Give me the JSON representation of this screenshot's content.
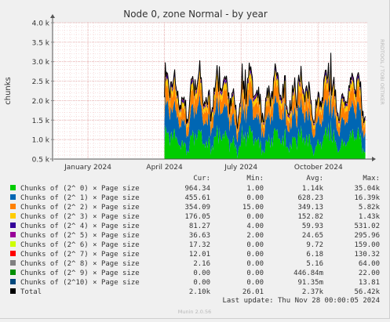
{
  "chart_data": {
    "type": "area",
    "title": "Node 0, zone Normal - by year",
    "ylabel": "chunks",
    "watermark": "RRDTOOL / TOBI OETIKER",
    "ylim": [
      500,
      4000
    ],
    "yticks": [
      {
        "value": 500,
        "label": "0.5 k"
      },
      {
        "value": 1000,
        "label": "1.0 k"
      },
      {
        "value": 1500,
        "label": "1.5 k"
      },
      {
        "value": 2000,
        "label": "2.0 k"
      },
      {
        "value": 2500,
        "label": "2.5 k"
      },
      {
        "value": 3000,
        "label": "3.0 k"
      },
      {
        "value": 3500,
        "label": "3.5 k"
      },
      {
        "value": 4000,
        "label": "4.0 k"
      }
    ],
    "x_range": [
      "2023-11-20",
      "2024-11-28"
    ],
    "xticks": [
      {
        "date": "2024-01-01",
        "label": "January 2024"
      },
      {
        "date": "2024-04-01",
        "label": "April 2024"
      },
      {
        "date": "2024-07-01",
        "label": "July 2024"
      },
      {
        "date": "2024-10-01",
        "label": "October 2024"
      }
    ],
    "data_start": "2024-04-01",
    "grid": true,
    "legend_header": {
      "cur": "Cur:",
      "min": "Min:",
      "avg": "Avg:",
      "max": "Max:"
    },
    "series": [
      {
        "name": "Chunks of (2^ 0) × Page size",
        "color": "#00cc00",
        "cur": "964.34",
        "min": "1.00",
        "avg": "1.14k",
        "max": "35.04k",
        "level": 900
      },
      {
        "name": "Chunks of (2^ 1) × Page size",
        "color": "#0066b3",
        "cur": "455.61",
        "min": "0.00",
        "avg": "628.23",
        "max": "16.39k",
        "level": 560
      },
      {
        "name": "Chunks of (2^ 2) × Page size",
        "color": "#ff8000",
        "cur": "354.09",
        "min": "15.00",
        "avg": "349.13",
        "max": "5.82k",
        "level": 310
      },
      {
        "name": "Chunks of (2^ 3) × Page size",
        "color": "#ffcc00",
        "cur": "176.05",
        "min": "0.00",
        "avg": "152.82",
        "max": "1.43k",
        "level": 130
      },
      {
        "name": "Chunks of (2^ 4) × Page size",
        "color": "#330099",
        "cur": "81.27",
        "min": "4.00",
        "avg": "59.93",
        "max": "531.02",
        "level": 55
      },
      {
        "name": "Chunks of (2^ 5) × Page size",
        "color": "#990099",
        "cur": "36.63",
        "min": "2.00",
        "avg": "24.65",
        "max": "295.96",
        "level": 24
      },
      {
        "name": "Chunks of (2^ 6) × Page size",
        "color": "#ccff00",
        "cur": "17.32",
        "min": "0.00",
        "avg": "9.72",
        "max": "159.00",
        "level": 10
      },
      {
        "name": "Chunks of (2^ 7) × Page size",
        "color": "#ff0000",
        "cur": "12.01",
        "min": "0.00",
        "avg": "6.18",
        "max": "130.32",
        "level": 6
      },
      {
        "name": "Chunks of (2^ 8) × Page size",
        "color": "#808080",
        "cur": "2.16",
        "min": "0.00",
        "avg": "5.16",
        "max": "64.00",
        "level": 5
      },
      {
        "name": "Chunks of (2^ 9) × Page size",
        "color": "#008f00",
        "cur": "0.00",
        "min": "0.00",
        "avg": "446.84m",
        "max": "22.00",
        "level": 0.4
      },
      {
        "name": "Chunks of (2^10) × Page size",
        "color": "#00487d",
        "cur": "0.00",
        "min": "0.00",
        "avg": "91.35m",
        "max": "13.81",
        "level": 0.1
      },
      {
        "name": "Total",
        "color": "#000000",
        "cur": "2.10k",
        "min": "26.01",
        "avg": "2.37k",
        "max": "56.42k",
        "is_total": true
      }
    ],
    "last_update": "Last update: Thu Nov 28 00:00:05 2024"
  },
  "footer": {
    "version": "Munin 2.0.56"
  }
}
